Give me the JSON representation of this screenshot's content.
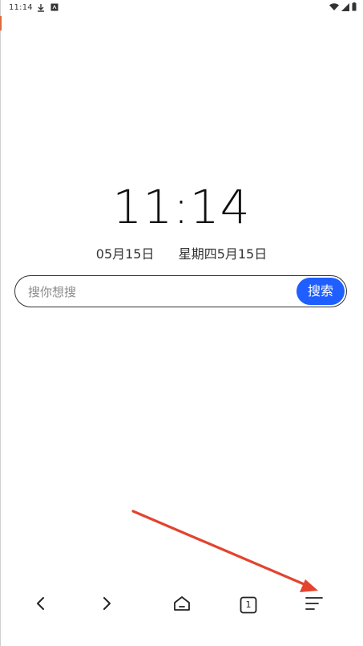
{
  "status_bar": {
    "time": "11:14",
    "icons": [
      "download-icon",
      "app-notification-icon",
      "wifi-icon",
      "signal-icon",
      "battery-icon"
    ]
  },
  "clock": {
    "time": "11:14",
    "date": "05月15日",
    "lunar": "星期四5月15日"
  },
  "search": {
    "placeholder": "搜你想搜",
    "button_label": "搜索",
    "accent": "#1f5fff"
  },
  "bottom_nav": {
    "items": [
      {
        "name": "back",
        "icon": "chevron-left-icon"
      },
      {
        "name": "forward",
        "icon": "chevron-right-icon"
      },
      {
        "name": "home",
        "icon": "home-icon"
      },
      {
        "name": "tabs",
        "icon": "tabs-icon",
        "count": "1"
      },
      {
        "name": "menu",
        "icon": "menu-icon"
      }
    ]
  },
  "annotation": {
    "color": "#e2442e",
    "target": "menu-button"
  }
}
